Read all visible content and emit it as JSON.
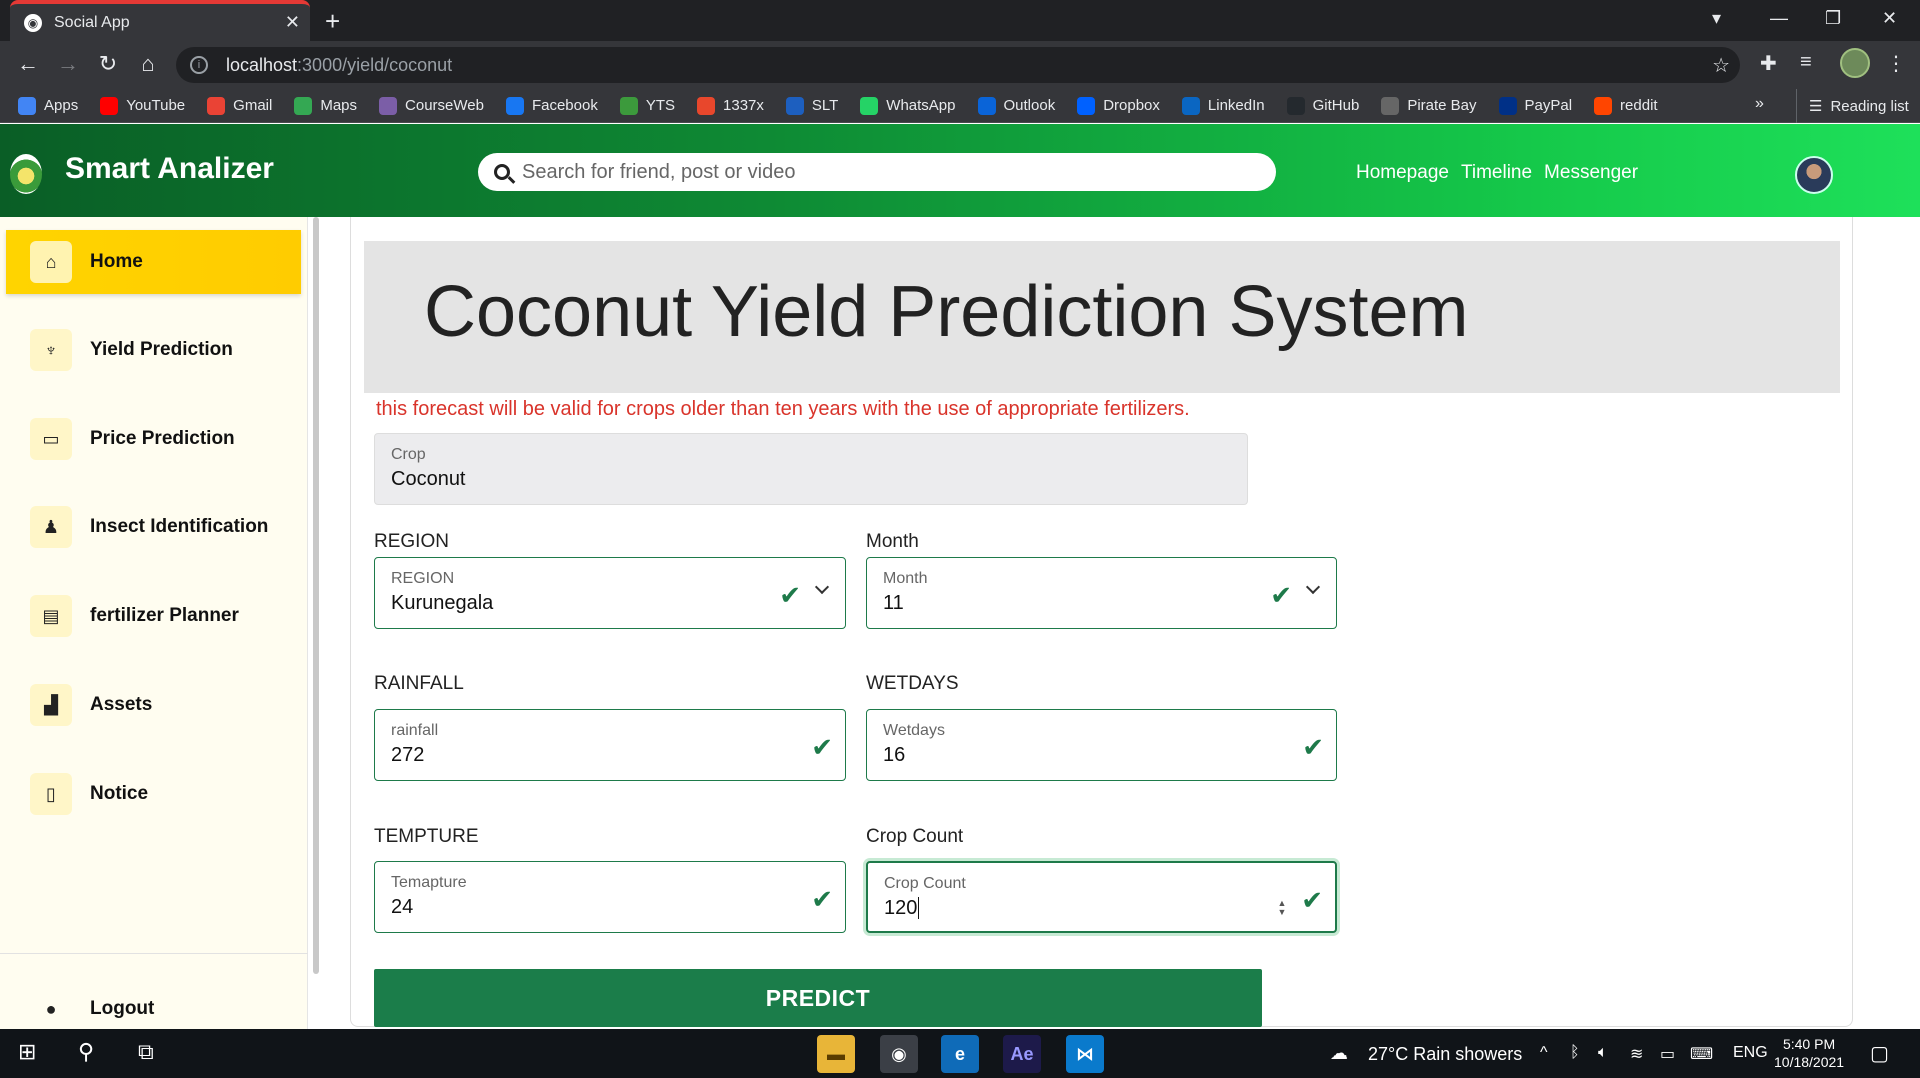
{
  "browser": {
    "tab_title": "Social App",
    "url_host": "localhost",
    "url_path": ":3000/yield/coconut",
    "bookmarks": [
      {
        "label": "Apps",
        "icon": "apps-grid-icon",
        "color": "#4285f4"
      },
      {
        "label": "YouTube",
        "icon": "youtube-icon",
        "color": "#ff0000"
      },
      {
        "label": "Gmail",
        "icon": "gmail-icon",
        "color": "#ea4335"
      },
      {
        "label": "Maps",
        "icon": "maps-icon",
        "color": "#34a853"
      },
      {
        "label": "CourseWeb",
        "icon": "courseweb-icon",
        "color": "#7b5ea7"
      },
      {
        "label": "Facebook",
        "icon": "facebook-icon",
        "color": "#1877f2"
      },
      {
        "label": "YTS",
        "icon": "yts-icon",
        "color": "#3c9a3c"
      },
      {
        "label": "1337x",
        "icon": "1337x-icon",
        "color": "#e8472c"
      },
      {
        "label": "SLT",
        "icon": "slt-icon",
        "color": "#1d5fbf"
      },
      {
        "label": "WhatsApp",
        "icon": "whatsapp-icon",
        "color": "#25d366"
      },
      {
        "label": "Outlook",
        "icon": "outlook-icon",
        "color": "#0a64d8"
      },
      {
        "label": "Dropbox",
        "icon": "dropbox-icon",
        "color": "#0061ff"
      },
      {
        "label": "LinkedIn",
        "icon": "linkedin-icon",
        "color": "#0a66c2"
      },
      {
        "label": "GitHub",
        "icon": "github-icon",
        "color": "#24292e"
      },
      {
        "label": "Pirate Bay",
        "icon": "piratebay-icon",
        "color": "#666666"
      },
      {
        "label": "PayPal",
        "icon": "paypal-icon",
        "color": "#003087"
      },
      {
        "label": "reddit",
        "icon": "reddit-icon",
        "color": "#ff4500"
      }
    ],
    "more_bookmarks": "»",
    "reading_list": "Reading list"
  },
  "header": {
    "brand": "Smart Analizer",
    "search_placeholder": "Search for friend, post or video",
    "nav": [
      "Homepage",
      "Timeline",
      "Messenger"
    ]
  },
  "sidebar": {
    "items": [
      {
        "label": "Home",
        "icon": "home-icon",
        "glyph": "⌂"
      },
      {
        "label": "Yield Prediction",
        "icon": "yield-icon",
        "glyph": "♆"
      },
      {
        "label": "Price Prediction",
        "icon": "book-icon",
        "glyph": "▭"
      },
      {
        "label": "Insect Identification",
        "icon": "insect-icon",
        "glyph": "♟"
      },
      {
        "label": "fertilizer Planner",
        "icon": "document-icon",
        "glyph": "▤"
      },
      {
        "label": "Assets",
        "icon": "assets-icon",
        "glyph": "▟"
      },
      {
        "label": "Notice",
        "icon": "notice-icon",
        "glyph": "▯"
      }
    ],
    "logout": {
      "label": "Logout",
      "icon": "user-icon",
      "glyph": "●"
    }
  },
  "main": {
    "title": "Coconut Yield Prediction System",
    "warning": "this forecast will be valid for crops older than ten years with the use of appropriate fertilizers.",
    "crop": {
      "label": "Crop",
      "value": "Coconut"
    },
    "region": {
      "heading": "REGION",
      "label": "REGION",
      "value": "Kurunegala"
    },
    "month": {
      "heading": "Month",
      "label": "Month",
      "value": "11"
    },
    "rainfall": {
      "heading": "RAINFALL",
      "label": "rainfall",
      "value": "272"
    },
    "wetdays": {
      "heading": "WETDAYS",
      "label": "Wetdays",
      "value": "16"
    },
    "temperature": {
      "heading": "TEMPTURE",
      "label": "Temapture",
      "value": "24"
    },
    "crop_count": {
      "heading": "Crop Count",
      "label": "Crop Count",
      "value": "120"
    },
    "predict_label": "PREDICT"
  },
  "taskbar": {
    "weather": "27°C  Rain showers",
    "language": "ENG",
    "time": "5:40 PM",
    "date": "10/18/2021"
  },
  "colors": {
    "accent_green": "#1b7d4a",
    "sidebar_active": "#ffd400",
    "warning_red": "#d9342b"
  }
}
